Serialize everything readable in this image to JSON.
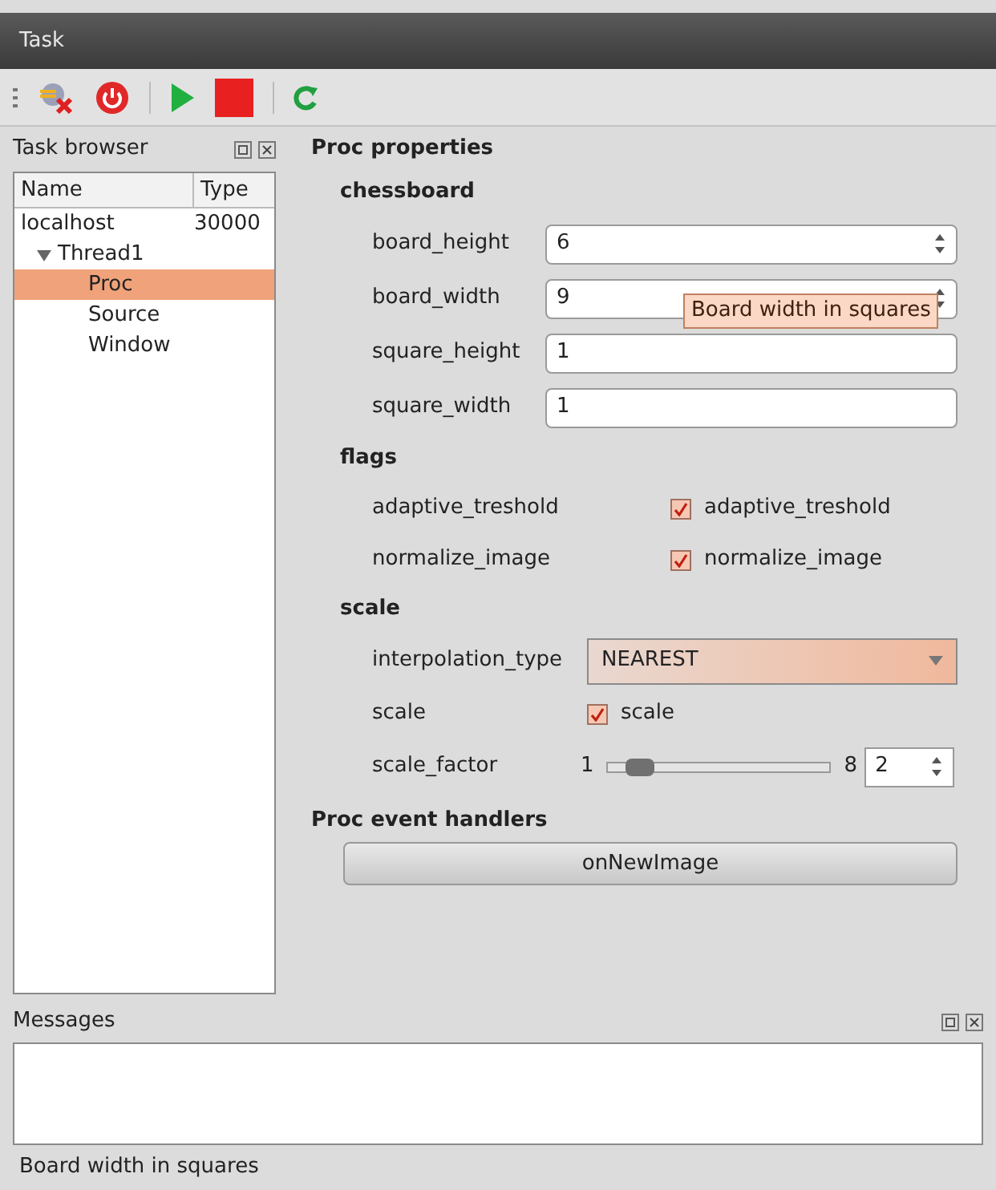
{
  "window": {
    "title": "Task"
  },
  "task_browser": {
    "title": "Task browser",
    "columns": [
      "Name",
      "Type"
    ],
    "tree": [
      {
        "name": "localhost",
        "type": "30000",
        "children": [
          {
            "name": "Thread1",
            "expanded": true,
            "children": [
              {
                "name": "Proc",
                "selected": true
              },
              {
                "name": "Source",
                "selected": false
              },
              {
                "name": "Window",
                "selected": false
              }
            ]
          }
        ]
      }
    ]
  },
  "properties": {
    "title": "Proc properties",
    "groups": [
      {
        "title": "chessboard",
        "rows": [
          {
            "kind": "spin",
            "label": "board_height",
            "value": "6"
          },
          {
            "kind": "spin",
            "label": "board_width",
            "value": "9"
          },
          {
            "kind": "text",
            "label": "square_height",
            "value": "1"
          },
          {
            "kind": "text",
            "label": "square_width",
            "value": "1"
          }
        ]
      },
      {
        "title": "flags",
        "rows": [
          {
            "kind": "check",
            "label": "adaptive_treshold",
            "text": "adaptive_treshold",
            "checked": true
          },
          {
            "kind": "check",
            "label": "normalize_image",
            "text": "normalize_image",
            "checked": true
          }
        ]
      },
      {
        "title": "scale",
        "rows": [
          {
            "kind": "combo",
            "label": "interpolation_type",
            "value": "NEAREST"
          },
          {
            "kind": "check2",
            "label": "scale",
            "text": "scale",
            "checked": true
          },
          {
            "kind": "slider",
            "label": "scale_factor",
            "min": "1",
            "max": "8",
            "level": 0.14,
            "value": "2"
          }
        ]
      }
    ]
  },
  "event_handlers": {
    "title": "Proc event handlers",
    "buttons": [
      "onNewImage"
    ]
  },
  "tooltip": {
    "text": "Board width in squares"
  },
  "messages": {
    "title": "Messages"
  },
  "status_bar": "Board width in squares"
}
